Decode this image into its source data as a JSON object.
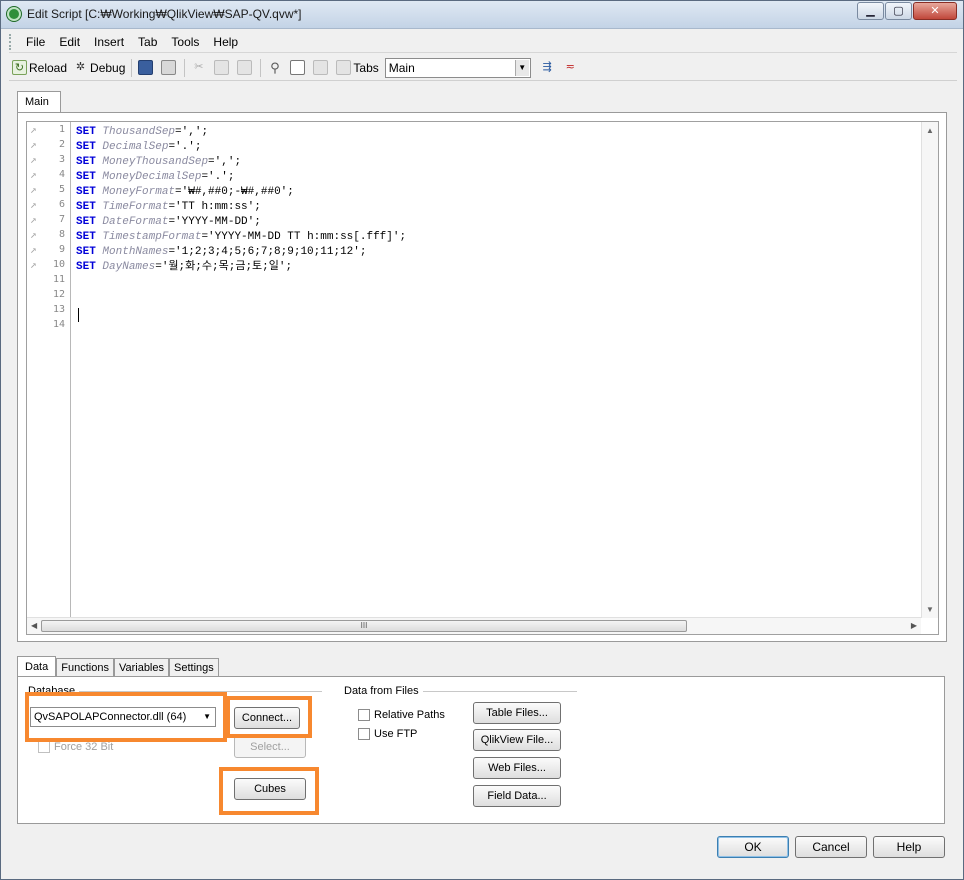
{
  "window": {
    "title": "Edit Script [C:₩Working₩QlikView₩SAP-QV.qvw*]"
  },
  "menubar": [
    "File",
    "Edit",
    "Insert",
    "Tab",
    "Tools",
    "Help"
  ],
  "toolbar": {
    "reload": "Reload",
    "debug": "Debug",
    "tabs_label": "Tabs",
    "tabs_value": "Main"
  },
  "editor": {
    "tab": "Main",
    "line_numbers": [
      "1",
      "2",
      "3",
      "4",
      "5",
      "6",
      "7",
      "8",
      "9",
      "10",
      "11",
      "12",
      "13",
      "14"
    ],
    "lines": [
      {
        "kw": "SET",
        "var": "ThousandSep",
        "val": "=',';"
      },
      {
        "kw": "SET",
        "var": "DecimalSep",
        "val": "='.';"
      },
      {
        "kw": "SET",
        "var": "MoneyThousandSep",
        "val": "=',';"
      },
      {
        "kw": "SET",
        "var": "MoneyDecimalSep",
        "val": "='.';"
      },
      {
        "kw": "SET",
        "var": "MoneyFormat",
        "val": "='₩#,##0;-₩#,##0';"
      },
      {
        "kw": "SET",
        "var": "TimeFormat",
        "val": "='TT h:mm:ss';"
      },
      {
        "kw": "SET",
        "var": "DateFormat",
        "val": "='YYYY-MM-DD';"
      },
      {
        "kw": "SET",
        "var": "TimestampFormat",
        "val": "='YYYY-MM-DD TT h:mm:ss[.fff]';"
      },
      {
        "kw": "SET",
        "var": "MonthNames",
        "val": "='1;2;3;4;5;6;7;8;9;10;11;12';"
      },
      {
        "kw": "SET",
        "var": "DayNames",
        "val": "='월;화;수;목;금;토;일';"
      }
    ],
    "hscroll_grip": "III"
  },
  "bottom_tabs": [
    "Data",
    "Functions",
    "Variables",
    "Settings"
  ],
  "data_panel": {
    "database_label": "Database",
    "database_value": "QvSAPOLAPConnector.dll (64)",
    "connect": "Connect...",
    "select": "Select...",
    "force32": "Force 32 Bit",
    "cubes": "Cubes",
    "files_label": "Data from Files",
    "relative_paths": "Relative Paths",
    "use_ftp": "Use FTP",
    "table_files": "Table Files...",
    "qlikview_file": "QlikView File...",
    "web_files": "Web Files...",
    "field_data": "Field Data..."
  },
  "footer": {
    "ok": "OK",
    "cancel": "Cancel",
    "help": "Help"
  },
  "colors": {
    "highlight": "#f7882f",
    "keyword": "#0000d8",
    "variable": "#8a8aa0"
  }
}
